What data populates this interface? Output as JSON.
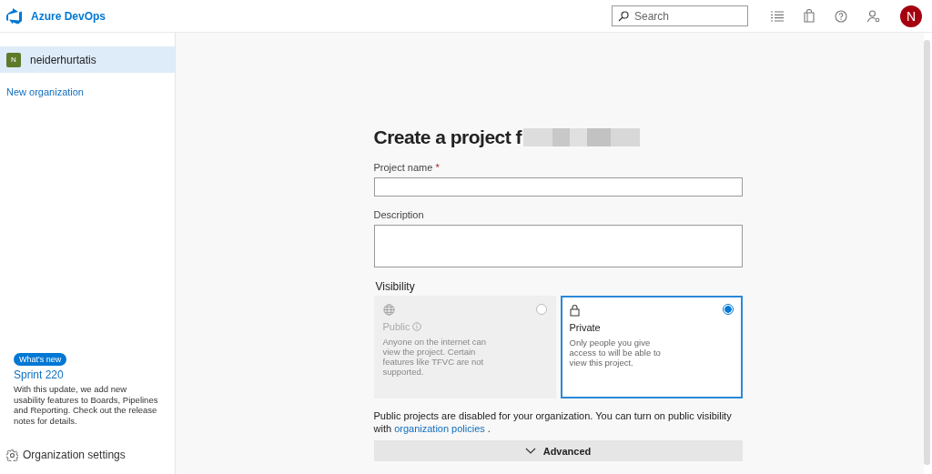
{
  "header": {
    "product": "Azure DevOps",
    "search": {
      "placeholder": "Search"
    },
    "avatar": "N"
  },
  "sidebar": {
    "organizations": [
      {
        "initial": "N",
        "name": "neiderhurtatis",
        "selected": true
      }
    ],
    "new_organization": "New organization",
    "whats_new": {
      "badge": "What's new",
      "title": "Sprint 220",
      "text": "With this update, we add new usability features to Boards, Pipelines and Reporting. Check out the release notes for details."
    },
    "settings": "Organization settings"
  },
  "form": {
    "title": "Create a project f",
    "title_redacted": true,
    "fields": [
      {
        "label": "Project name",
        "required_mark": "*",
        "kind": "input"
      },
      {
        "label": "Description",
        "kind": "textarea"
      }
    ],
    "visibility": {
      "label": "Visibility",
      "options": [
        {
          "kind": "public",
          "title": "Public",
          "text": "Anyone on the internet can view the project. Certain features like TFVC are not supported.",
          "selected": false,
          "disabled": true
        },
        {
          "kind": "private",
          "title": "Private",
          "text": "Only people you give access to will be able to view this project.",
          "selected": true,
          "disabled": false
        }
      ]
    },
    "notice": {
      "text": "Public projects are disabled for your organization. You can turn on public visibility with",
      "link": "organization policies",
      "end": "."
    },
    "advanced": {
      "label": "Advanced",
      "expanded": false
    }
  }
}
